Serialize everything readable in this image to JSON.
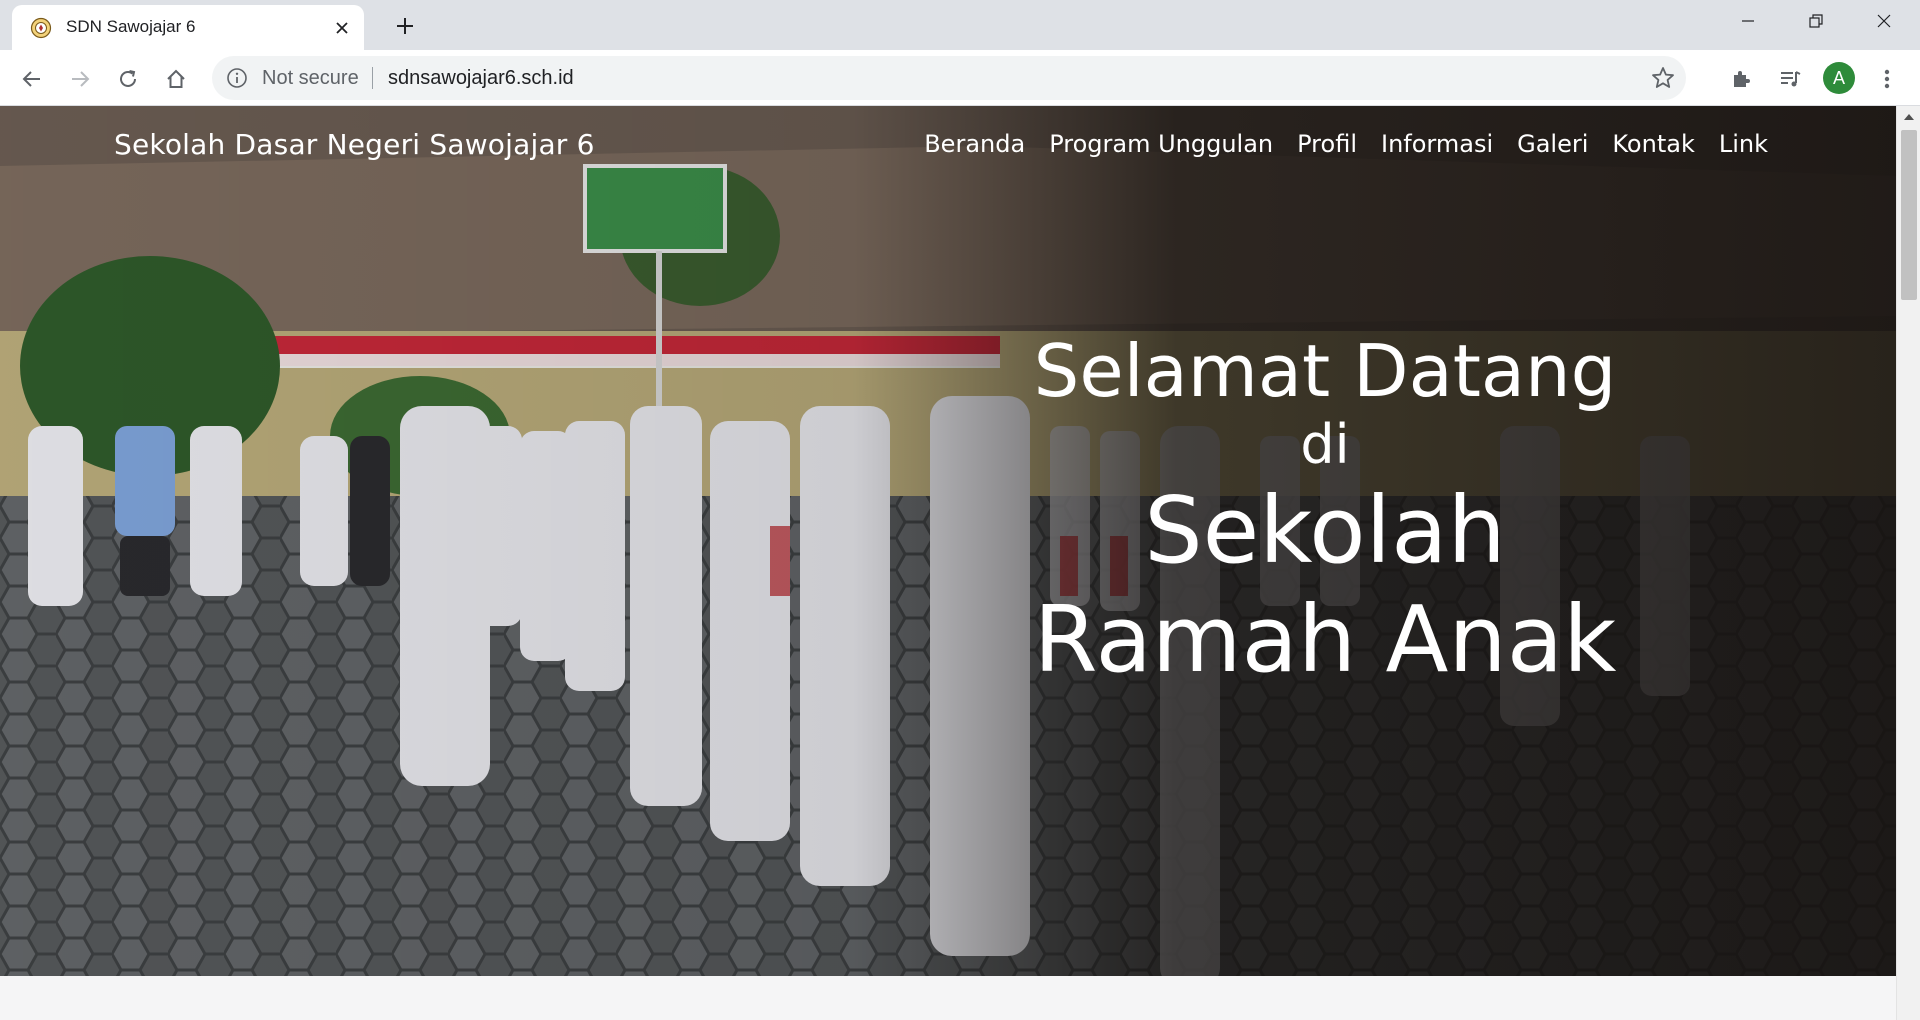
{
  "browser": {
    "tab": {
      "title": "SDN Sawojajar 6",
      "favicon": "school-emblem-icon"
    },
    "toolbar": {
      "security_label": "Not secure",
      "url": "sdnsawojajar6.sch.id",
      "profile_initial": "A"
    },
    "colors": {
      "tabstrip": "#dee1e6",
      "omnibox": "#f1f3f4",
      "avatar": "#2e8b3a"
    }
  },
  "site": {
    "brand": "Sekolah Dasar Negeri Sawojajar 6",
    "nav": [
      "Beranda",
      "Program Unggulan",
      "Profil",
      "Informasi",
      "Galeri",
      "Kontak",
      "Link"
    ]
  },
  "hero": {
    "line1": "Selamat Datang",
    "line2": "di",
    "line3": "Sekolah",
    "line4": "Ramah Anak"
  }
}
